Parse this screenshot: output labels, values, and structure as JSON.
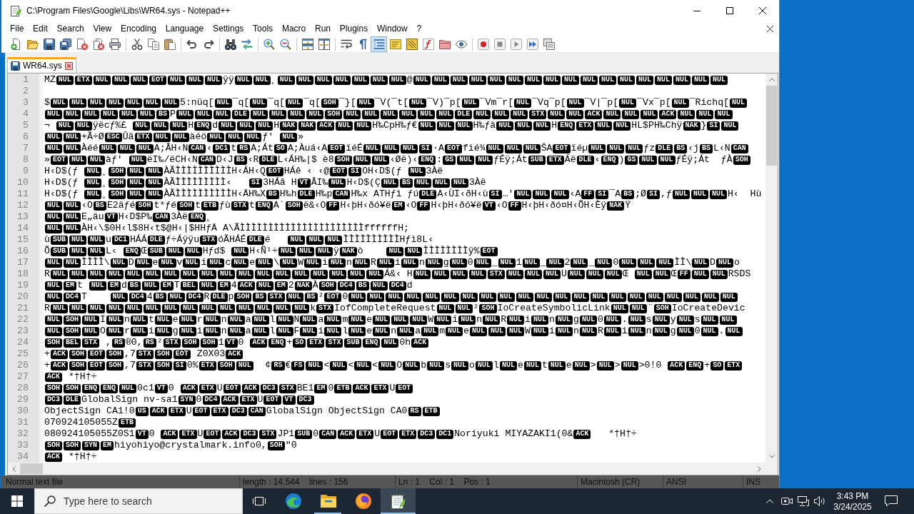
{
  "window": {
    "title": "C:\\Program Files\\Google\\Libs\\WR64.sys - Notepad++"
  },
  "menu": [
    "File",
    "Edit",
    "Search",
    "View",
    "Encoding",
    "Language",
    "Settings",
    "Tools",
    "Macro",
    "Run",
    "Plugins",
    "Window",
    "?"
  ],
  "toolbar": [
    [
      {
        "kind": "new",
        "pressed": false
      },
      {
        "kind": "open",
        "pressed": false
      },
      {
        "kind": "save",
        "pressed": false
      },
      {
        "kind": "save_all",
        "pressed": false
      },
      {
        "kind": "close",
        "pressed": false
      },
      {
        "kind": "close_all",
        "pressed": false
      },
      {
        "kind": "print",
        "pressed": false
      }
    ],
    [
      {
        "kind": "cut",
        "pressed": false
      },
      {
        "kind": "copy",
        "pressed": false
      },
      {
        "kind": "paste",
        "pressed": false
      }
    ],
    [
      {
        "kind": "undo",
        "pressed": false
      },
      {
        "kind": "redo",
        "pressed": false
      }
    ],
    [
      {
        "kind": "find",
        "pressed": false
      },
      {
        "kind": "replace",
        "pressed": false
      }
    ],
    [
      {
        "kind": "zoom_in",
        "pressed": false
      },
      {
        "kind": "zoom_out",
        "pressed": false
      }
    ],
    [
      {
        "kind": "sync_vertical",
        "pressed": false
      },
      {
        "kind": "sync_horizontal",
        "pressed": false
      }
    ],
    [
      {
        "kind": "wrap",
        "pressed": false
      },
      {
        "kind": "all_chars",
        "pressed": false
      },
      {
        "kind": "indent_guide",
        "pressed": true
      },
      {
        "kind": "udl",
        "pressed": false
      },
      {
        "kind": "doc_map",
        "pressed": false
      },
      {
        "kind": "function_list",
        "pressed": false
      },
      {
        "kind": "workspace",
        "pressed": false
      },
      {
        "kind": "monitor",
        "pressed": false
      }
    ],
    [
      {
        "kind": "record",
        "pressed": false
      },
      {
        "kind": "stop",
        "pressed": false
      },
      {
        "kind": "play",
        "pressed": false
      },
      {
        "kind": "play_multiple",
        "pressed": false
      },
      {
        "kind": "save_macro",
        "pressed": false
      }
    ]
  ],
  "tabs": [
    {
      "label": "WR64.sys",
      "selected": true
    }
  ],
  "editor": {
    "lines": [
      {
        "number": "1",
        "parts": [
          "MZ",
          [
            "NUL",
            "ETX",
            "NUL",
            "NUL",
            "NUL",
            "EOT",
            "NUL",
            "NUL",
            "NUL"
          ],
          "ÿÿ",
          [
            "NUL",
            "NUL"
          ],
          "¸",
          [
            "NUL",
            "NUL",
            "NUL",
            "NUL",
            "NUL",
            "NUL",
            "NUL"
          ],
          "@",
          [
            "NUL",
            "NUL",
            "NUL",
            "NUL",
            "NUL",
            "NUL",
            "NUL",
            "NUL",
            "NUL",
            "NUL",
            "NUL",
            "NUL",
            "NUL",
            "NUL",
            "NUL",
            "NUL",
            "NUL"
          ]
        ]
      },
      {
        "number": "2"
      },
      {
        "number": "3",
        "parts": [
          "$",
          [
            "NUL",
            "NUL",
            "NUL",
            "NUL",
            "NUL",
            "NUL",
            "NUL"
          ],
          "5:nüq[",
          [
            "NUL"
          ],
          "¯q[",
          [
            "NUL"
          ],
          "¯q[",
          [
            "NUL"
          ],
          "¯q[",
          [
            "SOH"
          ],
          "¯}[",
          [
            "NUL"
          ],
          "¯V(¯t[",
          [
            "NUL"
          ],
          "¯V)¯p[",
          [
            "NUL"
          ],
          "¯Vm¯r[",
          [
            "NUL"
          ],
          "¯Vq¯p[",
          [
            "NUL"
          ],
          "¯V|¯p[",
          [
            "NUL"
          ],
          "¯Vx¯p[",
          [
            "NUL"
          ],
          "¯Richq[",
          [
            "NUL"
          ]
        ]
      },
      {
        "number": "4",
        "parts": [
          [
            "NUL",
            "NUL",
            "NUL",
            "NUL",
            "NUL",
            "NUL",
            "BS"
          ],
          "P",
          [
            "NUL",
            "NUL",
            "NUL",
            "DLE",
            "NUL",
            "NUL",
            "NUL",
            "NUL",
            "SOH",
            "NUL",
            "NUL",
            "NUL",
            "NUL",
            "NUL",
            "NUL",
            "DLE",
            "NUL",
            "NUL",
            "NUL",
            "STX",
            "NUL",
            "NUL",
            "ACK",
            "NUL",
            "NUL",
            "NUL",
            "ACK",
            "NUL",
            "NUL",
            "NUL"
          ]
        ]
      },
      {
        "number": "5",
        "parts": [
          "¬ ",
          [
            "NUL",
            "NUL"
          ],
          "ÿëcƒ%£ ",
          [
            "NUL",
            "NUL",
            "NUL"
          ],
          "H",
          [
            "ENQ"
          ],
          "d",
          [
            "NUL",
            "NUL",
            "NUL"
          ],
          "H",
          [
            "NAK",
            "NAK",
            "ACK",
            "NUL",
            "NUL"
          ],
          "H‰CpH‰ƒ€",
          [
            "NUL",
            "NUL",
            "NUL"
          ],
          "H‰ƒà",
          [
            "NUL",
            "NUL",
            "NUL"
          ],
          "H",
          [
            "ENQ",
            "ETX",
            "NUL",
            "NUL"
          ],
          "HL$PH‰Chÿ",
          [
            "NAK"
          ],
          "}",
          [
            "SI",
            "NUL"
          ]
        ]
      },
      {
        "number": "6",
        "parts": [
          [
            "NUL",
            "NUL"
          ],
          "+Ã÷Ø",
          [
            "ESC"
          ],
          "Ûã",
          [
            "ETX",
            "NUL",
            "NUL"
          ],
          "àéö",
          [
            "NUL",
            "NUL",
            "NUL"
          ],
          "ƒ' ",
          [
            "NUL"
          ],
          "»"
        ]
      },
      {
        "number": "7",
        "parts": [
          [
            "NUL",
            "NUL"
          ],
          "Àéé",
          [
            "NUL",
            "NUL",
            "NUL"
          ],
          "A;ÂH‹N",
          [
            "CAN"
          ],
          "‹",
          [
            "DC1"
          ],
          "t",
          [
            "RS"
          ],
          "A;Át",
          [
            "SO"
          ],
          "A;Àuá‹A",
          [
            "EOT"
          ],
          "ïéÉ",
          [
            "NUL",
            "NUL",
            "NUL",
            "SI"
          ],
          "·A",
          [
            "EOT"
          ],
          "fié¾",
          [
            "NUL",
            "NUL",
            "NUL"
          ],
          "ŠA",
          [
            "EOT"
          ],
          "ïéµ",
          [
            "NUL",
            "NUL",
            "NUL"
          ],
          "ƒz",
          [
            "DLE",
            "BS"
          ],
          "‹j",
          [
            "BS"
          ],
          "L‹N",
          [
            "CAN"
          ]
        ]
      },
      {
        "number": "8",
        "parts": [
          "»",
          [
            "EOT",
            "NUL",
            "NUL"
          ],
          "àƒ' ",
          [
            "NUL"
          ],
          "ëI‰/ëCH‹N",
          [
            "CAN"
          ],
          "D‹J",
          [
            "BS"
          ],
          "‹R",
          [
            "DLE"
          ],
          "L‹ÁH‰|$ è8",
          [
            "SOH",
            "NUL",
            "NUL"
          ],
          "‹Øë)‹",
          [
            "ENQ"
          ],
          ":",
          [
            "GS",
            "NUL",
            "NUL"
          ],
          "ƒÉÿ;Át",
          [
            "SUB",
            "ETX"
          ],
          "Áë",
          [
            "DLE"
          ],
          "‹",
          [
            "ENQ"
          ],
          ")",
          [
            "GS",
            "NUL",
            "NUL"
          ],
          "ƒÉÿ;Át  ƒÀ",
          [
            "SOH"
          ]
        ]
      },
      {
        "number": "9",
        "parts": [
          "H‹D$(ƒ ",
          [
            "NUL"
          ],
          "¸",
          [
            "SOH",
            "NUL",
            "NUL"
          ],
          "ÀÃÌÌÌÌÌÌÌÌÌÌH‹ÁH‹Q",
          [
            "EOT"
          ],
          "HÁê ‹ ‹@",
          [
            "EOT",
            "SI"
          ],
          "OH‹D$(ƒ ",
          [
            "NUL"
          ],
          "3Àë"
        ]
      },
      {
        "number": "10",
        "parts": [
          "H‹D$(ƒ ",
          [
            "NUL"
          ],
          "¸",
          [
            "SOH",
            "NUL",
            "NUL"
          ],
          "ÀÃÌÌÌÌÌÌÌÌÌ‹   ",
          [
            "SI"
          ],
          "3HÁâ H",
          [
            "VT"
          ],
          "ÂI‰",
          [
            "NUL"
          ],
          "H‹D$(Ç",
          [
            "NUL",
            "BS",
            "NUL",
            "NUL",
            "NUL"
          ],
          "3Àë"
        ]
      },
      {
        "number": "11",
        "parts": [
          "H‹D$(ƒ ",
          [
            "NUL"
          ],
          "¸",
          [
            "SOH",
            "NUL",
            "NUL"
          ],
          "ÀÃÌÌÌÌÌÌÌÌÌÌH‹ÄH‰X",
          [
            "BS"
          ],
          "H‰h",
          [
            "DLE"
          ],
          "H‰p",
          [
            "CAN"
          ],
          "H‰x ATHƒì ƒú",
          [
            "DLE"
          ],
          "A‹ÙI‹ðH‹ù",
          [
            "SI"
          ],
          "…'",
          [
            "NUL",
            "NUL",
            "NUL"
          ],
          "‹A",
          [
            "FF",
            "SI"
          ],
          "¯A",
          [
            "BS"
          ],
          ";Ø",
          [
            "SI"
          ],
          ",ƒ",
          [
            "NUL",
            "NUL",
            "NUL"
          ],
          "H‹  Hù"
        ]
      },
      {
        "number": "12",
        "parts": [
          [
            "NUL",
            "NUL"
          ],
          "‹O",
          [
            "BS"
          ],
          "E2äƒé",
          [
            "SOH"
          ],
          "t*ƒé",
          [
            "SOH"
          ],
          "t",
          [
            "ETB"
          ],
          "ƒù",
          [
            "STX"
          ],
          "t",
          [
            "ENQ"
          ],
          "A´",
          [
            "SOH"
          ],
          "ë&‹O",
          [
            "FF"
          ],
          "H‹þH‹ðó¥ë",
          [
            "EM"
          ],
          "‹O",
          [
            "FF"
          ],
          "H‹þH‹ðó¥ë",
          [
            "VT"
          ],
          "‹O",
          [
            "FF"
          ],
          "H‹þH‹ðó¤H‹ÕH‹Èÿ",
          [
            "NAK"
          ],
          "Ÿ"
        ]
      },
      {
        "number": "13",
        "parts": [
          [
            "NUL",
            "NUL"
          ],
          "E„äu",
          [
            "VT"
          ],
          "H‹D$P‰",
          [
            "CAN"
          ],
          "3Àë",
          [
            "ENQ"
          ],
          "¸"
        ]
      },
      {
        "number": "14",
        "parts": [
          [
            "NUL",
            "NUL"
          ],
          "ÀH‹\\$0H‹l$8H‹t$@H‹|$HHƒÄ A\\ÃÌÌÌÌÌÌÌÌÌÌÌÌÌÌÌÌÌÌÌÌÌÌffffffH;"
        ]
      },
      {
        "number": "15",
        "parts": [
          "ù",
          [
            "SUB",
            "NUL",
            "NUL"
          ],
          "u",
          [
            "DC1"
          ],
          "HÁÁ",
          [
            "DLE"
          ],
          "ƒ÷Áÿÿu",
          [
            "STX"
          ],
          "óÃHÁÉ",
          [
            "DLE"
          ],
          "é   ",
          [
            "NUL",
            "NUL",
            "NUL"
          ],
          "ÌÌÌÌÌÌÌÌÌÌHƒì8L‹"
        ]
      },
      {
        "number": "16",
        "parts": [
          "Õ",
          [
            "SUB",
            "NUL",
            "NUL"
          ],
          "L‹ ",
          [
            "ENQ"
          ],
          "Œ",
          [
            "SUB",
            "NUL",
            "NUL"
          ],
          "Hƒd$ ",
          [
            "NUL"
          ],
          "H‹Ñ¹÷",
          [
            "NUL",
            "NUL",
            "NUL"
          ],
          "ÿ",
          [
            "NAK"
          ],
          "ò    ",
          [
            "NUL",
            "NUL"
          ],
          "ÌÌÌÌÌÌÌÌÿ%",
          [
            "EOT"
          ]
        ]
      },
      {
        "number": "17",
        "parts": [
          [
            "NUL",
            "NUL"
          ],
          "ÌÌÌÌ\\",
          [
            "NUL"
          ],
          "D",
          [
            "NUL"
          ],
          "e",
          [
            "NUL"
          ],
          "v",
          [
            "NUL"
          ],
          "i",
          [
            "NUL"
          ],
          "c",
          [
            "NUL"
          ],
          "e",
          [
            "NUL"
          ],
          "\\",
          [
            "NUL"
          ],
          "W",
          [
            "NUL"
          ],
          "i",
          [
            "NUL"
          ],
          "n",
          [
            "NUL"
          ],
          "R",
          [
            "NUL"
          ],
          "i",
          [
            "NUL"
          ],
          "n",
          [
            "NUL"
          ],
          "g",
          [
            "NUL"
          ],
          "0",
          [
            "NUL"
          ],
          "_",
          [
            "NUL"
          ],
          "1",
          [
            "NUL"
          ],
          "_",
          [
            "NUL"
          ],
          "2",
          [
            "NUL"
          ],
          "_",
          [
            "NUL"
          ],
          "0",
          [
            "NUL",
            "NUL",
            "NUL"
          ],
          "ÌÌ\\",
          [
            "NUL"
          ],
          "D",
          [
            "NUL"
          ],
          "o"
        ]
      },
      {
        "number": "18",
        "parts": [
          "R",
          [
            "NUL",
            "NUL",
            "NUL",
            "NUL",
            "NUL",
            "NUL",
            "NUL",
            "NUL",
            "NUL",
            "NUL",
            "NUL",
            "NUL",
            "NUL",
            "NUL",
            "NUL",
            "NUL",
            "NUL",
            "NUL"
          ],
          "Á&‹ H",
          [
            "NUL",
            "NUL",
            "NUL",
            "NUL",
            "STX",
            "NUL",
            "NUL",
            "NUL"
          ],
          "U",
          [
            "NUL",
            "NUL",
            "NUL"
          ],
          "Œ ",
          [
            "NUL",
            "NUL"
          ],
          "Œ",
          [
            "FF",
            "NUL",
            "NUL"
          ],
          "RSDS"
        ]
      },
      {
        "number": "19",
        "parts": [
          [
            "NUL",
            "EM"
          ],
          "t ",
          [
            "NUL",
            "EM"
          ],
          "d",
          [
            "BS",
            "NUL",
            "EM"
          ],
          "T",
          [
            "BEL",
            "NUL",
            "EM"
          ],
          "4",
          [
            "ACK",
            "NUL",
            "EM"
          ],
          "2",
          [
            "NAK"
          ],
          "À",
          [
            "SOH",
            "DC4",
            "BS",
            "NUL",
            "DC4"
          ],
          "d"
        ]
      },
      {
        "number": "20",
        "parts": [
          [
            "NUL",
            "DC4"
          ],
          "T    ",
          [
            "NUL",
            "DC4"
          ],
          "4",
          [
            "BS",
            "NUL",
            "DC4"
          ],
          "R",
          [
            "DLE"
          ],
          "p",
          [
            "SOH",
            "BS",
            "STX",
            "NUL",
            "BS"
          ],
          "²",
          [
            "EOT"
          ],
          "0",
          [
            "NUL",
            "NUL",
            "NUL",
            "NUL",
            "NUL",
            "NUL",
            "NUL",
            "NUL",
            "NUL",
            "NUL",
            "NUL",
            "NUL",
            "NUL",
            "NUL",
            "NUL",
            "NUL",
            "NUL",
            "NUL",
            "NUL",
            "NUL",
            "NUL"
          ]
        ]
      },
      {
        "number": "21",
        "parts": [
          "R",
          [
            "NUL",
            "NUL",
            "NUL",
            "NUL",
            "NUL",
            "NUL",
            "NUL",
            "NUL",
            "NUL",
            "NUL",
            "NUL",
            "NUL",
            "NUL",
            "NUL"
          ],
          "k",
          [
            "STX"
          ],
          "IofCompleteRequest",
          [
            "NUL",
            "NUL"
          ],
          "²",
          [
            "SOH"
          ],
          "IoCreateSymbolicLink",
          [
            "NUL",
            "NUL"
          ],
          "¨",
          [
            "SOH"
          ],
          "IoCreateDevic"
        ]
      },
      {
        "number": "22",
        "parts": [
          [
            "NUL",
            "SOH",
            "NUL"
          ],
          "I",
          [
            "NUL"
          ],
          "n",
          [
            "NUL"
          ],
          "t",
          [
            "NUL"
          ],
          "e",
          [
            "NUL"
          ],
          "r",
          [
            "NUL"
          ],
          "n",
          [
            "NUL"
          ],
          "a",
          [
            "NUL"
          ],
          "l",
          [
            "NUL"
          ],
          "N",
          [
            "NUL"
          ],
          "a",
          [
            "NUL"
          ],
          "m",
          [
            "NUL"
          ],
          "e",
          [
            "NUL",
            "NUL",
            "NUL"
          ],
          "W",
          [
            "NUL"
          ],
          "i",
          [
            "NUL"
          ],
          "n",
          [
            "NUL"
          ],
          "R",
          [
            "NUL"
          ],
          "i",
          [
            "NUL"
          ],
          "n",
          [
            "NUL"
          ],
          "g",
          [
            "NUL"
          ],
          "0",
          [
            "NUL"
          ],
          ".",
          [
            "NUL"
          ],
          "s",
          [
            "NUL"
          ],
          "y",
          [
            "NUL"
          ],
          "s",
          [
            "NUL",
            "NUL"
          ]
        ]
      },
      {
        "number": "23",
        "parts": [
          [
            "NUL",
            "SOH",
            "NUL"
          ],
          "O",
          [
            "NUL"
          ],
          "r",
          [
            "NUL"
          ],
          "i",
          [
            "NUL"
          ],
          "g",
          [
            "NUL"
          ],
          "i",
          [
            "NUL"
          ],
          "n",
          [
            "NUL"
          ],
          "a",
          [
            "NUL"
          ],
          "l",
          [
            "NUL"
          ],
          "F",
          [
            "NUL"
          ],
          "i",
          [
            "NUL"
          ],
          "l",
          [
            "NUL"
          ],
          "e",
          [
            "NUL"
          ],
          "n",
          [
            "NUL"
          ],
          "a",
          [
            "NUL"
          ],
          "m",
          [
            "NUL"
          ],
          "e",
          [
            "NUL",
            "NUL",
            "NUL"
          ],
          "W",
          [
            "NUL"
          ],
          "i",
          [
            "NUL"
          ],
          "n",
          [
            "NUL"
          ],
          "R",
          [
            "NUL"
          ],
          "i",
          [
            "NUL"
          ],
          "n",
          [
            "NUL"
          ],
          "g",
          [
            "NUL"
          ],
          "0",
          [
            "NUL"
          ],
          ".",
          [
            "NUL"
          ]
        ]
      },
      {
        "number": "24",
        "parts": [
          [
            "SOH",
            "BEL",
            "STX"
          ],
          " ,",
          [
            "RS"
          ],
          "®0,",
          [
            "RS"
          ],
          "²",
          [
            "STX",
            "SOH",
            "SOH"
          ],
          "1",
          [
            "VT"
          ],
          "0 ",
          [
            "ACK",
            "ENQ"
          ],
          "+",
          [
            "SO",
            "ETX",
            "STX",
            "SUB",
            "ENQ",
            "NUL"
          ],
          "0h",
          [
            "ACK"
          ]
        ]
      },
      {
        "number": "25",
        "parts": [
          "+",
          [
            "ACK",
            "SOH",
            "EOT",
            "SOH"
          ],
          ",7",
          [
            "STX",
            "SOH",
            "EOT"
          ],
          " Z0X03",
          [
            "ACK"
          ]
        ]
      },
      {
        "number": "26",
        "parts": [
          "+",
          [
            "ACK",
            "SOH",
            "EOT",
            "SOH"
          ],
          ",7",
          [
            "STX",
            "SOH",
            "SI"
          ],
          "0%",
          [
            "ETX",
            "SOH",
            "NUL"
          ],
          "  ¢",
          [
            "RS"
          ],
          "€",
          [
            "FS",
            "NUL"
          ],
          "<",
          [
            "NUL"
          ],
          "<",
          [
            "NUL"
          ],
          "<",
          [
            "NUL"
          ],
          "O",
          [
            "NUL"
          ],
          "b",
          [
            "NUL"
          ],
          "s",
          [
            "NUL"
          ],
          "o",
          [
            "NUL"
          ],
          "l",
          [
            "NUL"
          ],
          "e",
          [
            "NUL"
          ],
          "t",
          [
            "NUL"
          ],
          "e",
          [
            "NUL"
          ],
          ">",
          [
            "NUL"
          ],
          ">",
          [
            "NUL"
          ],
          ">0!0 ",
          [
            "ACK",
            "ENQ"
          ],
          "+",
          [
            "SO",
            "ETX"
          ]
        ]
      },
      {
        "number": "27",
        "parts": [
          [
            "ACK"
          ],
          " *†H†÷"
        ]
      },
      {
        "number": "28",
        "parts": [
          [
            "SOH",
            "SOH",
            "ENQ",
            "ENQ",
            "NUL"
          ],
          "0c1",
          [
            "VT"
          ],
          "0 ",
          [
            "ACK",
            "ETX"
          ],
          "U",
          [
            "EOT",
            "ACK",
            "DC3",
            "STX"
          ],
          "BE1",
          [
            "EM"
          ],
          "0",
          [
            "ETB",
            "ACK",
            "ETX"
          ],
          "U",
          [
            "EOT"
          ]
        ]
      },
      {
        "number": "29",
        "parts": [
          [
            "DC3",
            "DLE"
          ],
          "GlobalSign nv-sa1",
          [
            "SYN"
          ],
          "0",
          [
            "DC4",
            "ACK",
            "ETX"
          ],
          "U",
          [
            "EOT",
            "VT",
            "DC3"
          ]
        ]
      },
      {
        "number": "30",
        "parts": [
          "ObjectSign CA1!0",
          [
            "US",
            "ACK",
            "ETX"
          ],
          "U",
          [
            "EOT",
            "ETX",
            "DC3",
            "CAN"
          ],
          "GlobalSign ObjectSign CA0",
          [
            "RS",
            "ETB"
          ]
        ]
      },
      {
        "number": "31",
        "parts": [
          "070924105055Z",
          [
            "ETB"
          ]
        ]
      },
      {
        "number": "32",
        "parts": [
          "080924105055Z0S1",
          [
            "VT"
          ],
          "0 ",
          [
            "ACK",
            "ETX"
          ],
          "U",
          [
            "EOT",
            "ACK",
            "DC3",
            "STX"
          ],
          "JP1",
          [
            "SUB"
          ],
          "0",
          [
            "CAN",
            "ACK",
            "ETX"
          ],
          "U",
          [
            "EOT",
            "ETX",
            "DC3",
            "DC1"
          ],
          "Noriyuki MIYAZAKI1(0&",
          [
            "ACK"
          ],
          "   *†H†÷"
        ]
      },
      {
        "number": "33",
        "parts": [
          [
            "SOH",
            "SOH",
            "SYN",
            "EM"
          ],
          "hiyohiyo@crystalmark.info0,",
          [
            "SOH"
          ],
          "\"0"
        ]
      },
      {
        "number": "34",
        "parts": [
          [
            "ACK"
          ],
          " *†H†÷"
        ]
      }
    ]
  },
  "status_bar": [
    "Normal text file",
    "length : 14,544    lines : 156",
    "Ln : 1    Col : 1    Pos : 1",
    "Macintosh (CR)",
    "ANSI",
    "INS"
  ],
  "taskbar": {
    "search": {
      "placeholder": "Type here to search"
    },
    "apps": [
      {
        "kind": "task_view",
        "running": false,
        "selected": false
      },
      {
        "kind": "edge",
        "running": false,
        "selected": false
      },
      {
        "kind": "explorer",
        "running": true,
        "selected": false
      },
      {
        "kind": "firefox",
        "running": false,
        "selected": false
      },
      {
        "kind": "notepad",
        "running": true,
        "selected": true
      }
    ],
    "time": "3:43 PM",
    "date": "3/24/2025"
  }
}
